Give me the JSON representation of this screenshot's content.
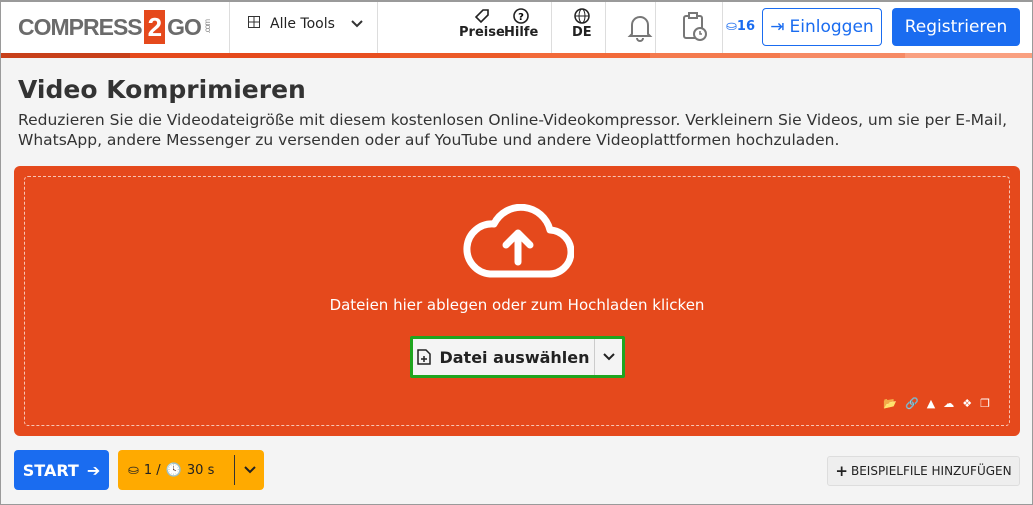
{
  "header": {
    "logo": "COMPRESS2GO.com",
    "logo_parts": [
      "COMPRESS",
      "2",
      "GO",
      ".com"
    ],
    "tools_label": "Alle Tools",
    "pricing": "Preise",
    "help": "Hilfe",
    "language": "DE",
    "credits": "16",
    "login": "Einloggen",
    "register": "Registrieren"
  },
  "colors": {
    "accent": "#e5491c",
    "primary": "#1a6cf0",
    "highlight": "#1fa51f",
    "options": "#ffaa00"
  },
  "page": {
    "title": "Video Komprimieren",
    "description": "Reduzieren Sie die Videodateigröße mit diesem kostenlosen Online-Videokompressor. Verkleinern Sie Videos, um sie per E-Mail, WhatsApp, andere Messenger zu versenden oder auf YouTube und andere Videoplattformen hochzuladen."
  },
  "dropzone": {
    "text": "Dateien hier ablegen oder zum Hochladen klicken",
    "choose_file": "Datei auswählen",
    "sources": [
      "folder-icon",
      "link-icon",
      "google-drive-icon",
      "onedrive-icon",
      "dropbox-icon",
      "clipboard-icon"
    ]
  },
  "footer": {
    "start": "START",
    "files": "1 /",
    "time": "30 s",
    "sample": "BEISPIELFILE HINZUFÜGEN"
  }
}
